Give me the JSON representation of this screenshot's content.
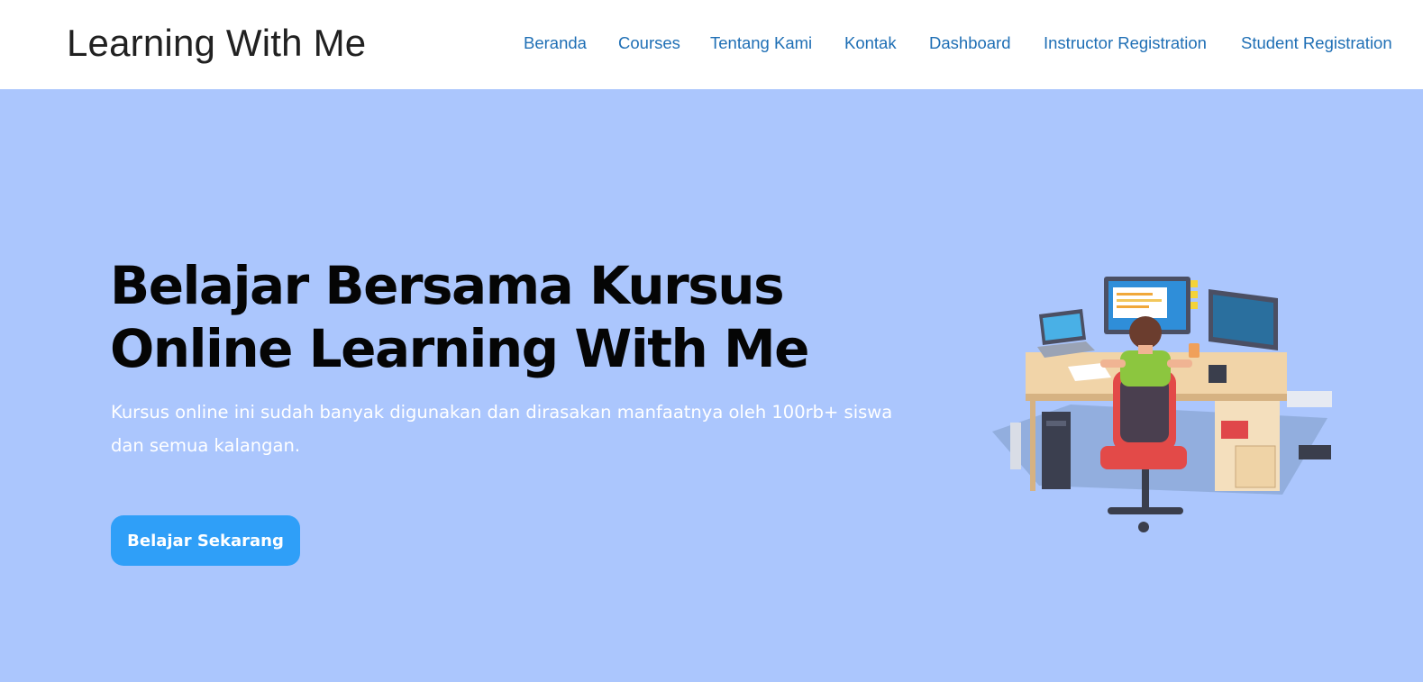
{
  "brand": "Learning With Me",
  "nav": {
    "items": [
      {
        "label": "Beranda"
      },
      {
        "label": "Courses"
      },
      {
        "label": "Tentang Kami"
      },
      {
        "label": "Kontak"
      },
      {
        "label": "Dashboard"
      },
      {
        "label": "Instructor Registration"
      },
      {
        "label": "Student Registration"
      }
    ]
  },
  "hero": {
    "title_line1": "Belajar Bersama Kursus",
    "title_line2": "Online Learning With Me",
    "subtitle": "Kursus online ini sudah banyak digunakan dan dirasakan manfaatnya oleh 100rb+ siswa dan semua kalangan.",
    "cta_label": "Belajar Sekarang"
  },
  "colors": {
    "hero_background": "#abc6fd",
    "nav_link": "#1f6fb5",
    "cta_background": "#2f9ff8"
  }
}
